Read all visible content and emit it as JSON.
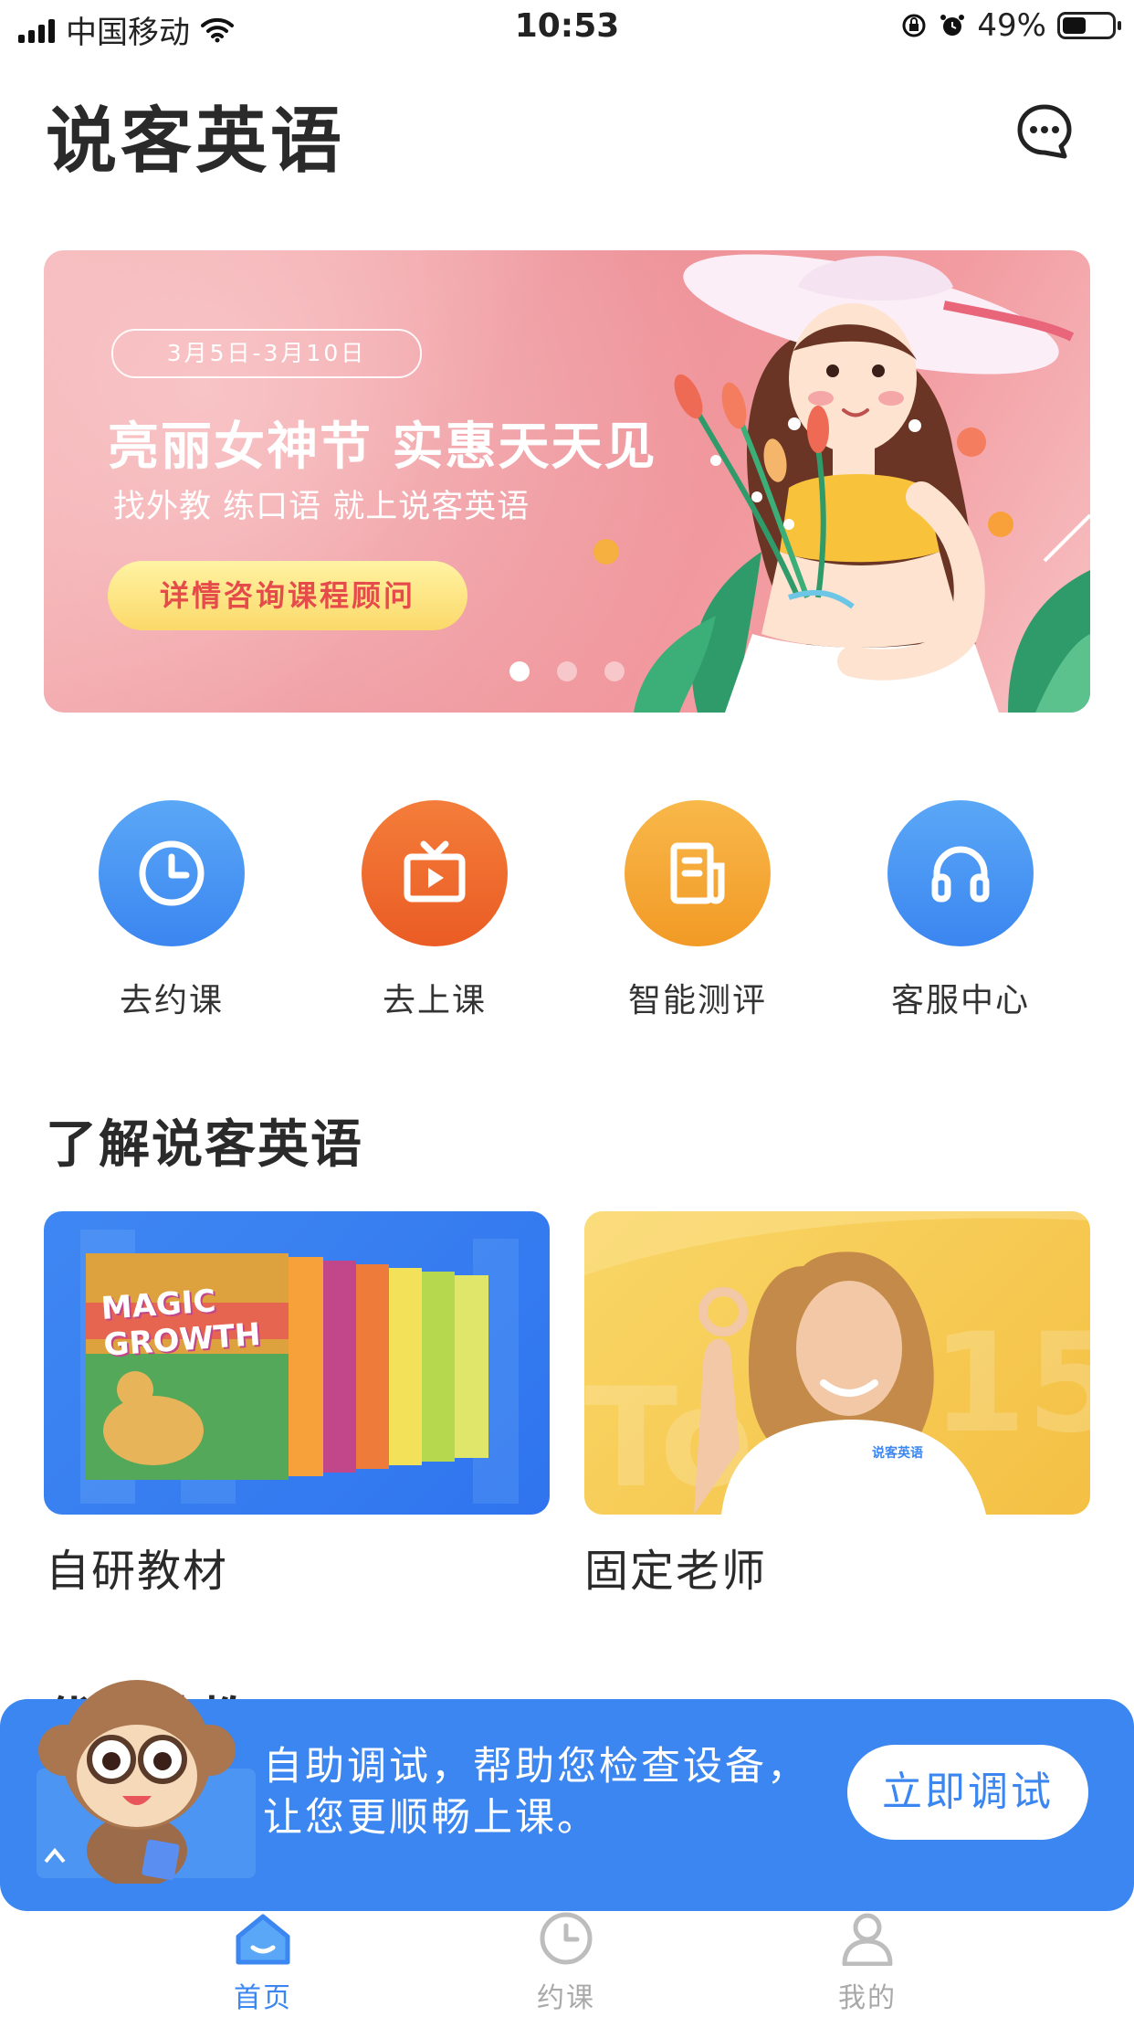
{
  "status_bar": {
    "carrier": "中国移动",
    "time": "10:53",
    "battery_percent": "49%",
    "battery_level": 0.49,
    "icons": [
      "signal-icon",
      "wifi-icon",
      "orientation-lock-icon",
      "alarm-icon",
      "battery-icon"
    ]
  },
  "header": {
    "title": "说客英语",
    "message_icon": "chat-bubble-icon"
  },
  "banner": {
    "date_range": "3月5日-3月10日",
    "headline": "亮丽女神节 实惠天天见",
    "subtitle": "找外教 练口语 就上说客英语",
    "cta_label": "详情咨询课程顾问",
    "page_count": 3,
    "active_page": 1
  },
  "quick_actions": [
    {
      "label": "去约课",
      "icon": "clock-icon",
      "color": "#4a94f2"
    },
    {
      "label": "去上课",
      "icon": "tv-play-icon",
      "color": "#ef6a2b"
    },
    {
      "label": "智能测评",
      "icon": "document-icon",
      "color": "#f5a836"
    },
    {
      "label": "客服中心",
      "icon": "headphones-icon",
      "color": "#4a94f2"
    }
  ],
  "section": {
    "title": "了解说客英语",
    "cards": [
      {
        "label": "自研教材",
        "art_text": "MAGIC GROWTH"
      },
      {
        "label": "固定老师",
        "art_text": "说客英语"
      }
    ],
    "next_section_peek": "优质外教"
  },
  "debug_banner": {
    "text_line1": "自助调试，帮助您检查设备，",
    "text_line2": "让您更顺畅上课。",
    "button_label": "立即调试"
  },
  "tab_bar": {
    "tabs": [
      {
        "label": "首页",
        "icon": "home-icon",
        "active": true
      },
      {
        "label": "约课",
        "icon": "clock-icon",
        "active": false
      },
      {
        "label": "我的",
        "icon": "user-icon",
        "active": false
      }
    ]
  },
  "colors": {
    "primary_blue": "#3b86f0",
    "orange": "#ef6a2b",
    "yellow": "#f5a836",
    "banner_pink": "#ec8f96"
  }
}
